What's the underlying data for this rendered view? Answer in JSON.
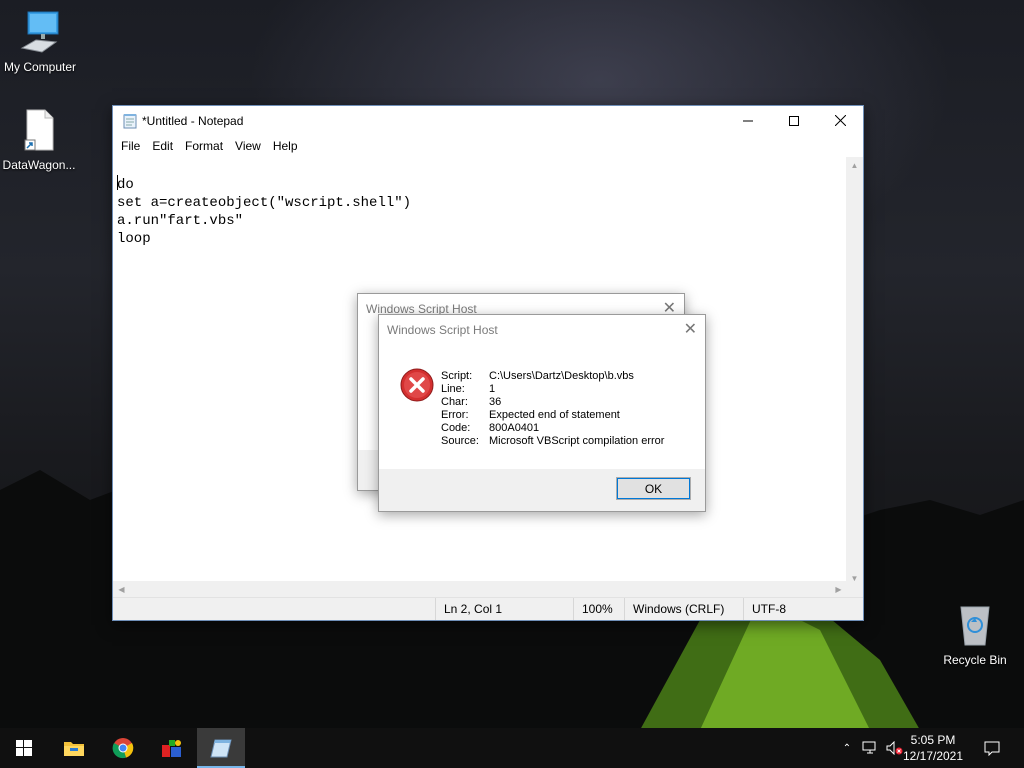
{
  "desktop": {
    "icons": [
      {
        "label": "My Computer"
      },
      {
        "label": "DataWagon..."
      },
      {
        "label": "Recycle Bin"
      }
    ]
  },
  "notepad": {
    "title": "*Untitled - Notepad",
    "menu": [
      "File",
      "Edit",
      "Format",
      "View",
      "Help"
    ],
    "lines": [
      "do",
      "set a=createobject(\"wscript.shell\")",
      "a.run\"fart.vbs\"",
      "loop"
    ],
    "status": {
      "position": "Ln 2, Col 1",
      "zoom": "100%",
      "line_ending": "Windows (CRLF)",
      "encoding": "UTF-8"
    }
  },
  "dialog_back": {
    "title": "Windows Script Host"
  },
  "dialog_front": {
    "title": "Windows Script Host",
    "fields": [
      {
        "label": "Script:",
        "value": "C:\\Users\\Dartz\\Desktop\\b.vbs"
      },
      {
        "label": "Line:",
        "value": "1"
      },
      {
        "label": "Char:",
        "value": "36"
      },
      {
        "label": "Error:",
        "value": "Expected end of statement"
      },
      {
        "label": "Code:",
        "value": "800A0401"
      },
      {
        "label": "Source:",
        "value": "Microsoft VBScript compilation error"
      }
    ],
    "ok_label": "OK"
  },
  "taskbar": {
    "apps": [
      "start-icon",
      "file-explorer-icon",
      "chrome-icon",
      "app-icon",
      "notepad-icon"
    ],
    "time": "5:05 PM",
    "date": "12/17/2021"
  },
  "colors": {
    "accent": "#0078d7",
    "error_red": "#d32f2f",
    "taskbar": "#101010"
  }
}
